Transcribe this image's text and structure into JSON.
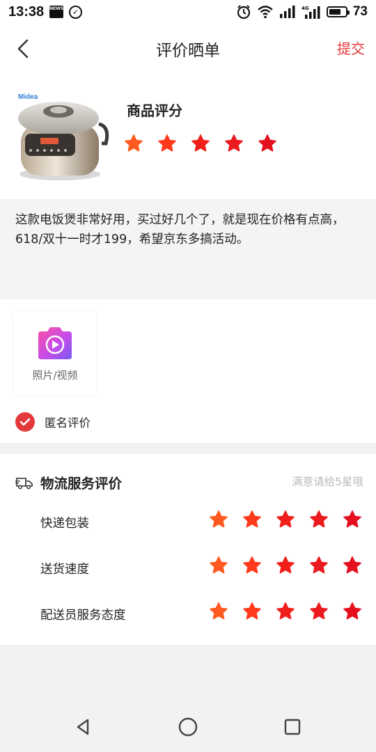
{
  "status_bar": {
    "time": "13:38",
    "news_label": "NEWS",
    "battery": "73",
    "network": "4G"
  },
  "nav": {
    "title": "评价晒单",
    "submit_label": "提交"
  },
  "product": {
    "brand": "Midea",
    "rating_title": "商品评分",
    "rating": 5,
    "max_rating": 5
  },
  "comment": {
    "text": "这款电饭煲非常好用，买过好几个了，就是现在价格有点高，618/双十一时才199，希望京东多搞活动。"
  },
  "media": {
    "upload_label": "照片/视频"
  },
  "anonymous": {
    "label": "匿名评价",
    "checked": true
  },
  "logistics": {
    "title": "物流服务评价",
    "hint": "满意请给5星哦",
    "rows": [
      {
        "label": "快递包装",
        "rating": 5
      },
      {
        "label": "送货速度",
        "rating": 5
      },
      {
        "label": "配送员服务态度",
        "rating": 5
      }
    ]
  },
  "colors": {
    "accent": "#e4393c",
    "star_gradient": [
      "#ff5a1f",
      "#ff3a1a",
      "#f01f1a",
      "#ea1a1f",
      "#e4101f"
    ]
  },
  "icons": {
    "back": "chevron-left-icon",
    "upload": "camera-video-icon",
    "anonymous": "checkmark-icon",
    "logistics": "truck-icon",
    "sys_back": "triangle-back-icon",
    "sys_home": "circle-home-icon",
    "sys_recent": "square-recent-icon"
  }
}
